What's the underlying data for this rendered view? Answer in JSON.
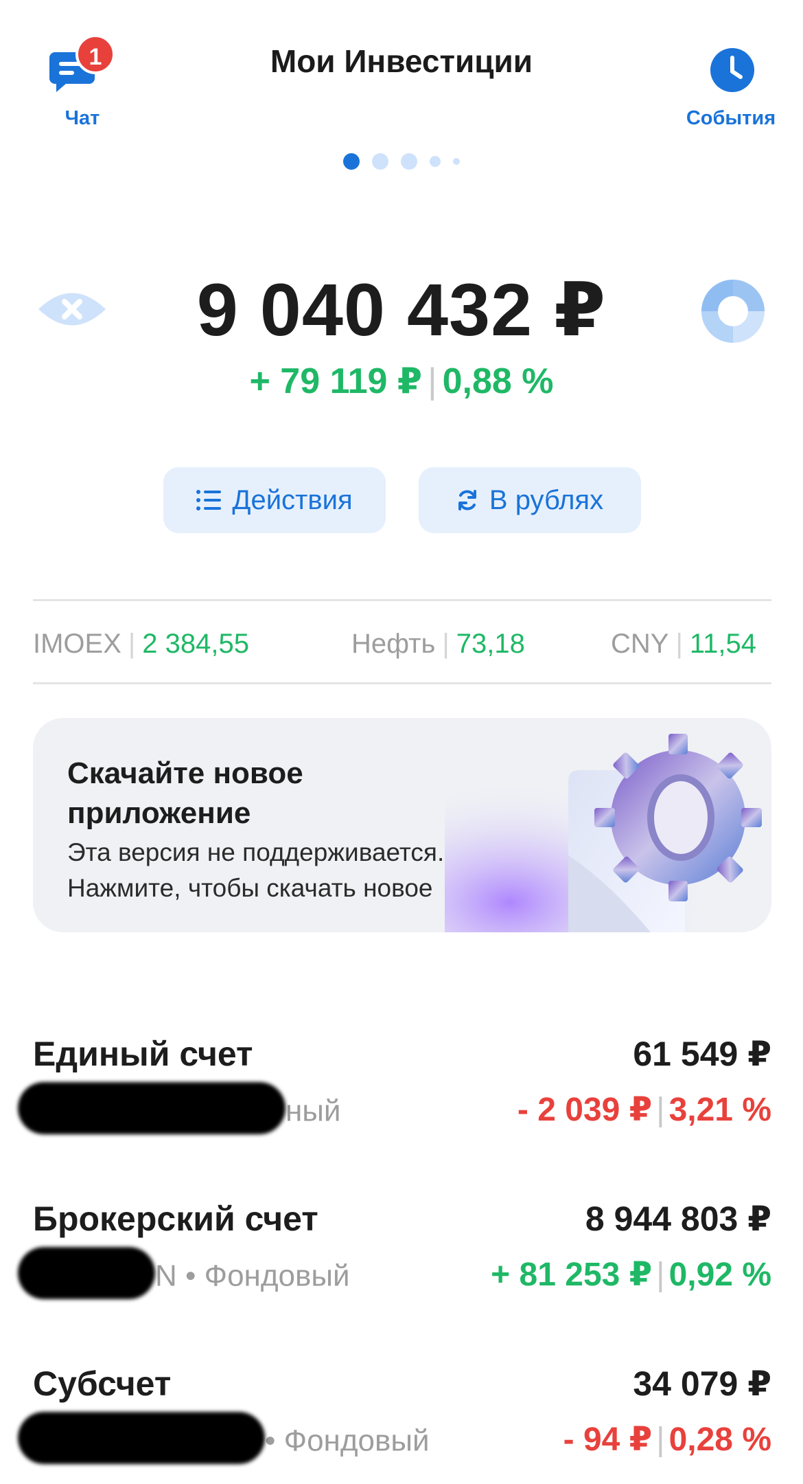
{
  "header": {
    "title": "Мои Инвестиции",
    "chat_label": "Чат",
    "chat_badge": "1",
    "events_label": "События",
    "pager": {
      "count": 5,
      "active": 1
    }
  },
  "balance": {
    "total": "9 040 432 ₽",
    "change_amount": "+ 79 119 ₽",
    "change_percent": "0,88 %"
  },
  "actions": {
    "actions_label": "Действия",
    "currency_label": "В рублях"
  },
  "ticker": [
    {
      "name": "IMOEX",
      "value": "2 384,55"
    },
    {
      "name": "Нефть",
      "value": "73,18"
    },
    {
      "name": "CNY",
      "value": "11,54"
    }
  ],
  "banner": {
    "title": "Скачайте новое приложение",
    "text": "Эта версия не поддерживается. Нажмите, чтобы скачать новое"
  },
  "accounts": [
    {
      "name": "Единый счет",
      "subtitle": "ный",
      "total": "61 549 ₽",
      "change_amount": "- 2 039 ₽",
      "change_percent": "3,21 %",
      "direction": "down"
    },
    {
      "name": "Брокерский счет",
      "subtitle": "N • Фондовый",
      "total": "8 944 803 ₽",
      "change_amount": "+ 81 253 ₽",
      "change_percent": "0,92 %",
      "direction": "up"
    },
    {
      "name": "Субсчет",
      "subtitle": "• Фондовый",
      "total": "34 079 ₽",
      "change_amount": "- 94 ₽",
      "change_percent": "0,28 %",
      "direction": "down"
    }
  ],
  "colors": {
    "accent": "#1a73d9",
    "positive": "#1fb866",
    "negative": "#e8413c",
    "badge": "#e8413c"
  }
}
